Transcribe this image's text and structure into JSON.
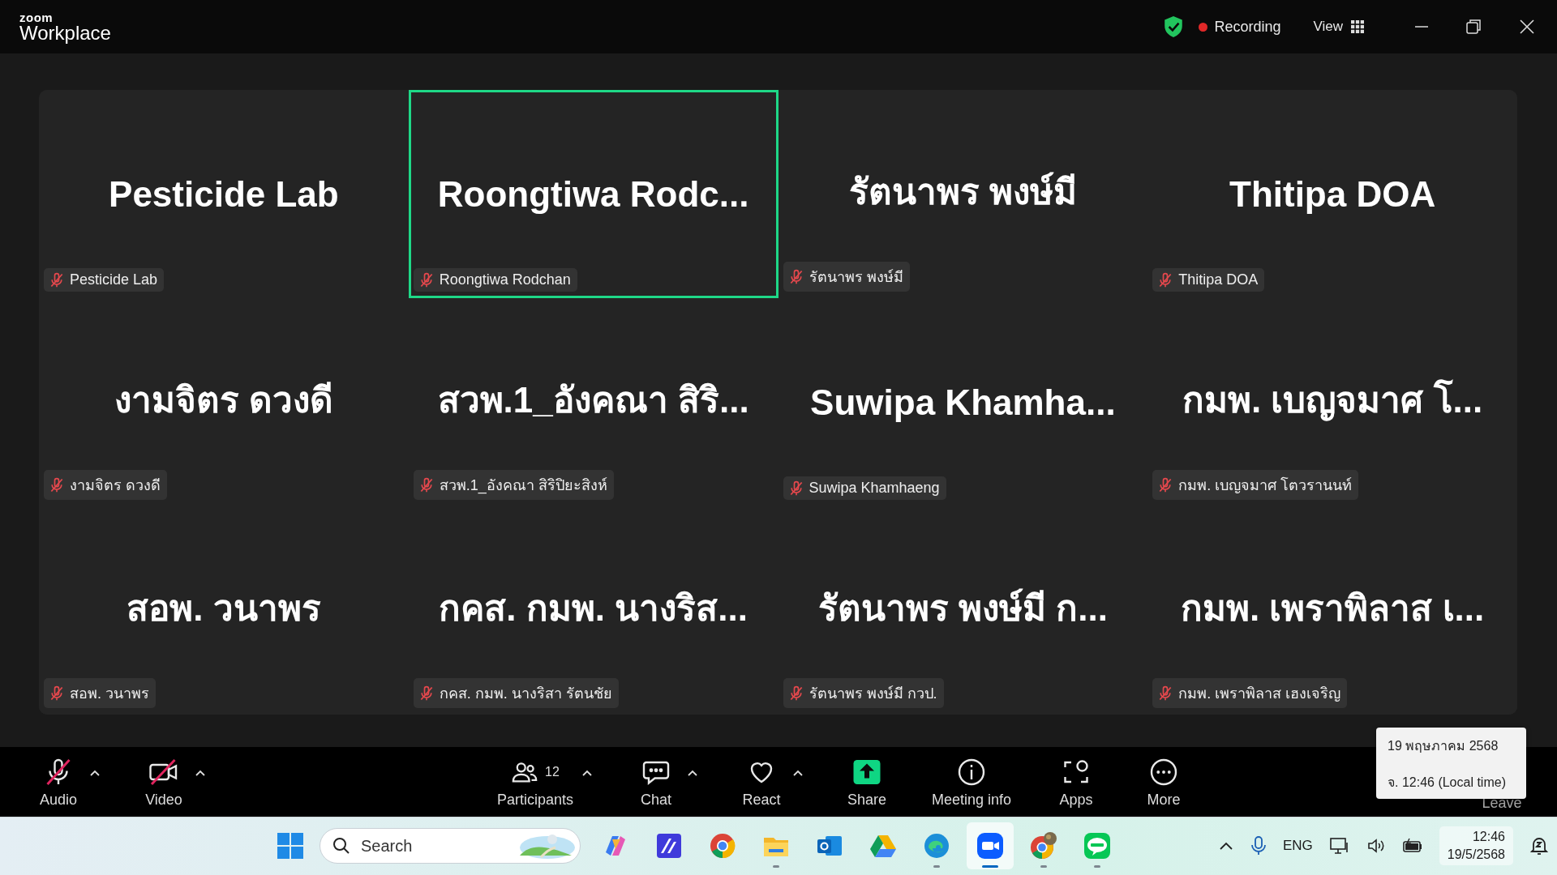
{
  "header": {
    "logo_top": "zoom",
    "logo_bottom": "Workplace",
    "recording": "Recording",
    "view": "View"
  },
  "tiles": [
    {
      "display_name": "Pesticide Lab",
      "tag": "Pesticide Lab",
      "muted": true,
      "speaking": false
    },
    {
      "display_name": "Roongtiwa  Rodc...",
      "tag": "Roongtiwa Rodchan",
      "muted": true,
      "speaking": true
    },
    {
      "display_name": "รัตนาพร พงษ์มี",
      "tag": "รัตนาพร พงษ์มี",
      "muted": true,
      "speaking": false
    },
    {
      "display_name": "Thitipa DOA",
      "tag": "Thitipa DOA",
      "muted": true,
      "speaking": false
    },
    {
      "display_name": "งามจิตร ดวงดี",
      "tag": "งามจิตร ดวงดี",
      "muted": true,
      "speaking": false
    },
    {
      "display_name": "สวพ.1_อังคณา สิริ...",
      "tag": "สวพ.1_อังคณา สิริปิยะสิงห์",
      "muted": true,
      "speaking": false
    },
    {
      "display_name": "Suwipa  Khamha...",
      "tag": "Suwipa Khamhaeng",
      "muted": true,
      "speaking": false
    },
    {
      "display_name": "กมพ. เบญจมาศ โ...",
      "tag": "กมพ. เบญจมาศ โตวรานนท์",
      "muted": true,
      "speaking": false
    },
    {
      "display_name": "สอพ. วนาพร",
      "tag": "สอพ. วนาพร",
      "muted": true,
      "speaking": false
    },
    {
      "display_name": "กคส. กมพ. นางริส...",
      "tag": "กคส. กมพ. นางริสา รัตนชัย",
      "muted": true,
      "speaking": false
    },
    {
      "display_name": "รัตนาพร พงษ์มี ก...",
      "tag": "รัตนาพร พงษ์มี กวป.",
      "muted": true,
      "speaking": false
    },
    {
      "display_name": "กมพ. เพราพิลาส เ...",
      "tag": "กมพ. เพราพิลาส เฮงเจริญ",
      "muted": true,
      "speaking": false
    }
  ],
  "toolbar": [
    {
      "kind": "audio",
      "label": "Audio",
      "off": true,
      "caret": true
    },
    {
      "kind": "video",
      "label": "Video",
      "off": true,
      "caret": true
    },
    {
      "kind": "participants",
      "label": "Participants",
      "count": "12",
      "caret": true
    },
    {
      "kind": "chat",
      "label": "Chat",
      "caret": true
    },
    {
      "kind": "react",
      "label": "React",
      "caret": true
    },
    {
      "kind": "share",
      "label": "Share",
      "caret": false
    },
    {
      "kind": "info",
      "label": "Meeting info",
      "caret": false
    },
    {
      "kind": "apps",
      "label": "Apps",
      "caret": false
    },
    {
      "kind": "more",
      "label": "More",
      "caret": false
    },
    {
      "kind": "leave",
      "label": "Leave",
      "caret": false
    }
  ],
  "tooltip": {
    "date": "19 พฤษภาคม 2568",
    "time": "จ. 12:46 (Local time)"
  },
  "taskbar": {
    "search_placeholder": "Search",
    "apps": [
      {
        "kind": "copilot",
        "running": false,
        "active": false
      },
      {
        "kind": "editor",
        "running": false,
        "active": false
      },
      {
        "kind": "chrome",
        "running": false,
        "active": false
      },
      {
        "kind": "files",
        "running": true,
        "active": false
      },
      {
        "kind": "outlook",
        "running": false,
        "active": false
      },
      {
        "kind": "drive",
        "running": false,
        "active": false
      },
      {
        "kind": "edge",
        "running": true,
        "active": false
      },
      {
        "kind": "zoom",
        "running": true,
        "active": true
      },
      {
        "kind": "chrome-profile",
        "running": true,
        "active": false
      },
      {
        "kind": "line",
        "running": true,
        "active": false
      }
    ],
    "language": "ENG",
    "time": "12:46",
    "date": "19/5/2568"
  }
}
